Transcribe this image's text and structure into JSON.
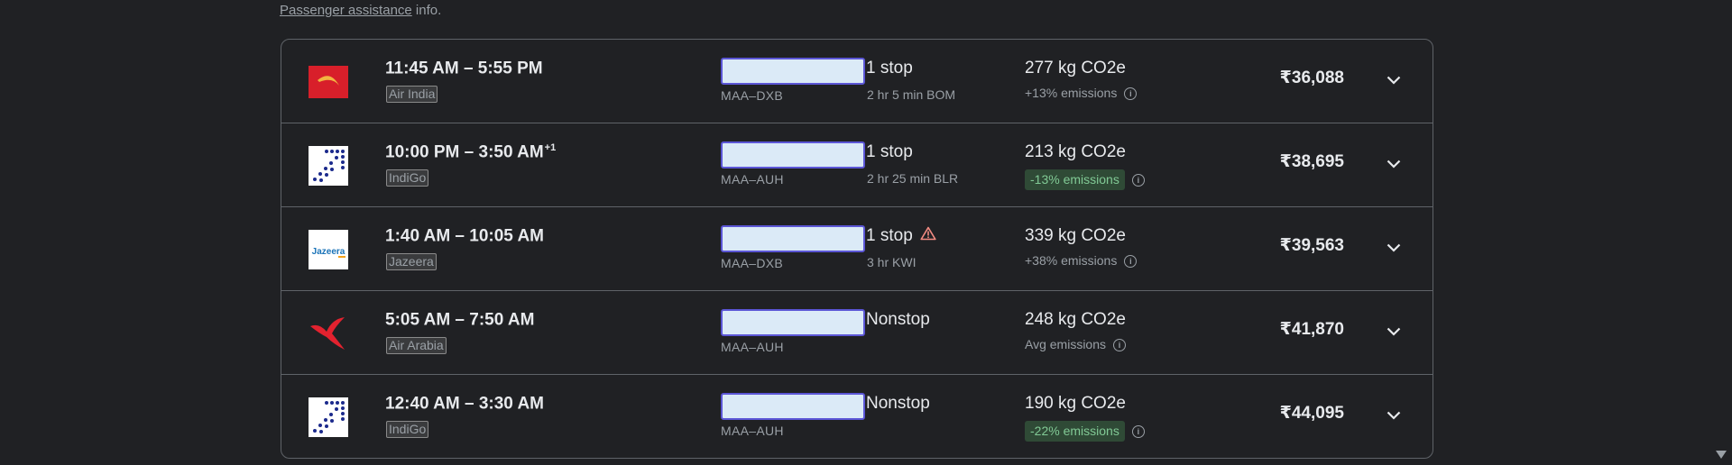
{
  "header": {
    "link_text": "Passenger assistance",
    "suffix_text": " info."
  },
  "flights": [
    {
      "times": "11:45 AM – 5:55 PM",
      "day_offset": "",
      "airline": "Air India",
      "logo_icon": "air-india-logo",
      "route": "MAA–DXB",
      "stops": "1 stop",
      "warning": false,
      "layover": "2 hr 5 min BOM",
      "co2": "277 kg CO2e",
      "emissions": "+13% emissions",
      "emissions_style": "plain",
      "price": "₹36,088"
    },
    {
      "times": "10:00 PM – 3:50 AM",
      "day_offset": "+1",
      "airline": "IndiGo",
      "logo_icon": "indigo-logo",
      "route": "MAA–AUH",
      "stops": "1 stop",
      "warning": false,
      "layover": "2 hr 25 min BLR",
      "co2": "213 kg CO2e",
      "emissions": "-13% emissions",
      "emissions_style": "low",
      "price": "₹38,695"
    },
    {
      "times": "1:40 AM – 10:05 AM",
      "day_offset": "",
      "airline": "Jazeera",
      "logo_icon": "jazeera-logo",
      "route": "MAA–DXB",
      "stops": "1 stop",
      "warning": true,
      "layover": "3 hr KWI",
      "co2": "339 kg CO2e",
      "emissions": "+38% emissions",
      "emissions_style": "plain",
      "price": "₹39,563"
    },
    {
      "times": "5:05 AM – 7:50 AM",
      "day_offset": "",
      "airline": "Air Arabia",
      "logo_icon": "air-arabia-logo",
      "route": "MAA–AUH",
      "stops": "Nonstop",
      "warning": false,
      "layover": "",
      "co2": "248 kg CO2e",
      "emissions": "Avg emissions",
      "emissions_style": "plain",
      "price": "₹41,870"
    },
    {
      "times": "12:40 AM – 3:30 AM",
      "day_offset": "",
      "airline": "IndiGo",
      "logo_icon": "indigo-logo",
      "route": "MAA–AUH",
      "stops": "Nonstop",
      "warning": false,
      "layover": "",
      "co2": "190 kg CO2e",
      "emissions": "-22% emissions",
      "emissions_style": "low",
      "price": "₹44,095"
    }
  ],
  "jazeera_logo_text": "Jazeera",
  "colors": {
    "background": "#202124",
    "border": "#5f6368",
    "low_emission_bg": "#2f4a36",
    "low_emission_text": "#81c995",
    "duration_box": "#dbeaf7",
    "duration_border": "#5b56d6",
    "warning": "#f28b82"
  }
}
